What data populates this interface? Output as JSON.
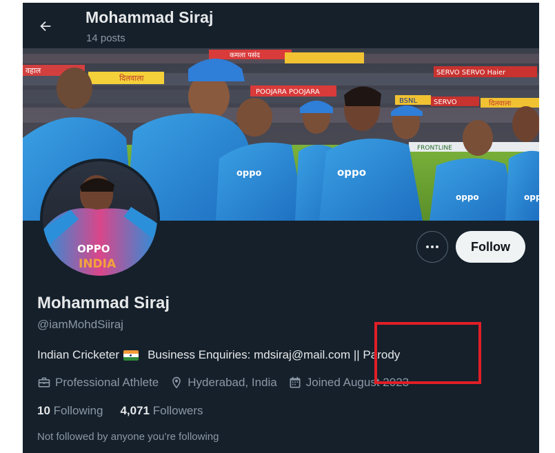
{
  "header": {
    "title": "Mohammad Siraj",
    "posts_count": "14 posts"
  },
  "banner": {
    "stand_signs": [
      "कमला पसंद",
      "वहाल",
      "दिलवाला",
      "POOJARA POOJARA",
      "SERVO SERVO Haier",
      "BSNL",
      "SERVO",
      "दिलवाला",
      "FRONTLINE",
      "oppo",
      "oppo",
      "oppo",
      "oppo"
    ],
    "jersey_text": "OPPO"
  },
  "avatar": {
    "jersey_brand": "OPPO",
    "jersey_country": "INDIA"
  },
  "actions": {
    "follow_label": "Follow"
  },
  "profile": {
    "display_name": "Mohammad Siraj",
    "handle": "@iamMohdSiiraj",
    "bio_before_flag": "Indian Cricketer",
    "bio_after_flag": "Business Enquiries: mdsiraj@mail.com || Parody",
    "category": "Professional Athlete",
    "location": "Hyderabad, India",
    "joined": "Joined August 2023",
    "following_count": "10",
    "following_label": "Following",
    "followers_count": "4,071",
    "followers_label": "Followers",
    "not_followed_note": "Not followed by anyone you’re following"
  },
  "colors": {
    "background": "#15202b",
    "primary_text": "#e7e9ea",
    "secondary_text": "#8b98a5",
    "follow_button": "#eff3f4",
    "highlight_box": "#e01e26"
  },
  "icons": [
    "back-arrow-icon",
    "more-dots-icon",
    "briefcase-icon",
    "location-pin-icon",
    "calendar-icon",
    "india-flag-icon"
  ]
}
